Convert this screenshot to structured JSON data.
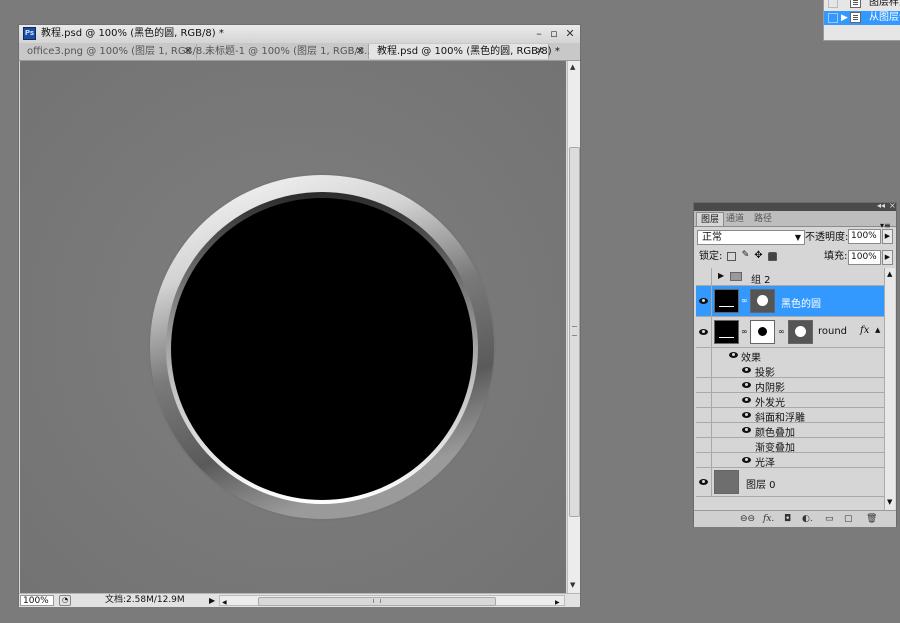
{
  "top_menu": {
    "items": [
      {
        "label": "图层样式",
        "selected": false
      },
      {
        "label": "从图层创建",
        "selected": true
      }
    ]
  },
  "document": {
    "title": "教程.psd @ 100% (黑色的圆, RGB/8) *",
    "app_icon": "Ps",
    "tabs": [
      {
        "label": "office3.png @ 100% (图层 1, RGB/8...",
        "active": false
      },
      {
        "label": "未标题-1 @ 100% (图层 1, RGB/8...",
        "active": false
      },
      {
        "label": "教程.psd @ 100% (黑色的圆, RGB/8) *",
        "active": true
      }
    ],
    "status": {
      "zoom": "100%",
      "doc_info": "文档:2.58M/12.9M"
    }
  },
  "layers_panel": {
    "tabs": [
      "图层",
      "通道",
      "路径"
    ],
    "active_tab": "图层",
    "blend_mode": "正常",
    "opacity_label": "不透明度:",
    "opacity": "100%",
    "lock_label": "锁定:",
    "fill_label": "填充:",
    "fill": "100%",
    "layers": [
      {
        "name": "组 2",
        "type": "group",
        "visible": false,
        "selected": false
      },
      {
        "name": "黑色的圆",
        "type": "layer",
        "visible": true,
        "selected": true
      },
      {
        "name": "round",
        "type": "layer",
        "visible": true,
        "selected": false,
        "fx": "fx"
      }
    ],
    "effects_label": "效果",
    "effects": [
      {
        "name": "投影",
        "visible": true
      },
      {
        "name": "内阴影",
        "visible": true
      },
      {
        "name": "外发光",
        "visible": true
      },
      {
        "name": "斜面和浮雕",
        "visible": true
      },
      {
        "name": "颜色叠加",
        "visible": true
      },
      {
        "name": "渐变叠加",
        "visible": false
      },
      {
        "name": "光泽",
        "visible": true
      }
    ],
    "background_layer": {
      "name": "图层 0",
      "visible": true
    },
    "colors": {
      "selected": "#3399ff"
    }
  }
}
